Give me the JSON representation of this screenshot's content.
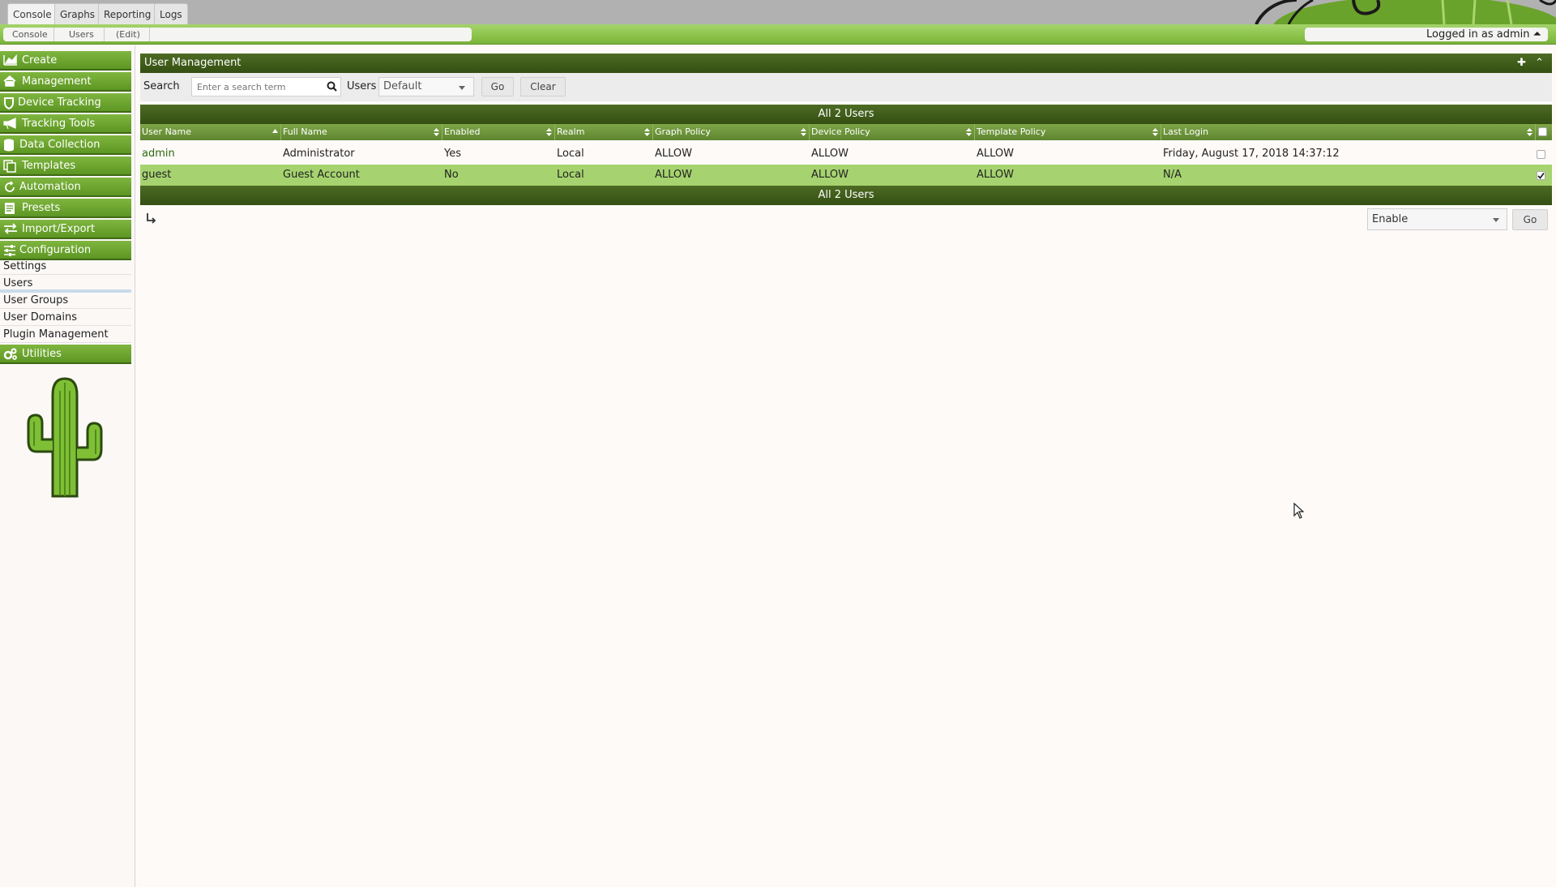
{
  "top_tabs": [
    "Console",
    "Graphs",
    "Reporting",
    "Logs"
  ],
  "breadcrumb": [
    "Console",
    "Users",
    "(Edit)"
  ],
  "user_status": "Logged in as admin ⏶",
  "sidebar": {
    "sections": [
      "Create",
      "Management",
      "Device Tracking",
      "Tracking Tools",
      "Data Collection",
      "Templates",
      "Automation",
      "Presets",
      "Import/Export",
      "Configuration"
    ],
    "config_items": [
      "Settings",
      "Users",
      "User Groups",
      "User Domains",
      "Plugin Management"
    ],
    "utilities": "Utilities"
  },
  "panel": {
    "title": "User Management",
    "search_label": "Search",
    "search_placeholder": "Enter a search term",
    "users_label": "Users",
    "users_select": "Default",
    "go": "Go",
    "clear": "Clear",
    "summary": "All 2 Users"
  },
  "table": {
    "columns": [
      "User Name",
      "Full Name",
      "Enabled",
      "Realm",
      "Graph Policy",
      "Device Policy",
      "Template Policy",
      "Last Login"
    ],
    "rows": [
      [
        "admin",
        "Administrator",
        "Yes",
        "Local",
        "ALLOW",
        "ALLOW",
        "ALLOW",
        "Friday, August 17, 2018 14:37:12"
      ],
      [
        "guest",
        "Guest Account",
        "No",
        "Local",
        "ALLOW",
        "ALLOW",
        "ALLOW",
        "N/A"
      ]
    ],
    "checked": [
      false,
      true
    ]
  },
  "bulk_action": {
    "selected": "Enable",
    "go": "Go"
  },
  "colors": {
    "accent_green": "#8bc34a",
    "dark_green": "#344f12",
    "row_highlight": "#a6d36f"
  }
}
